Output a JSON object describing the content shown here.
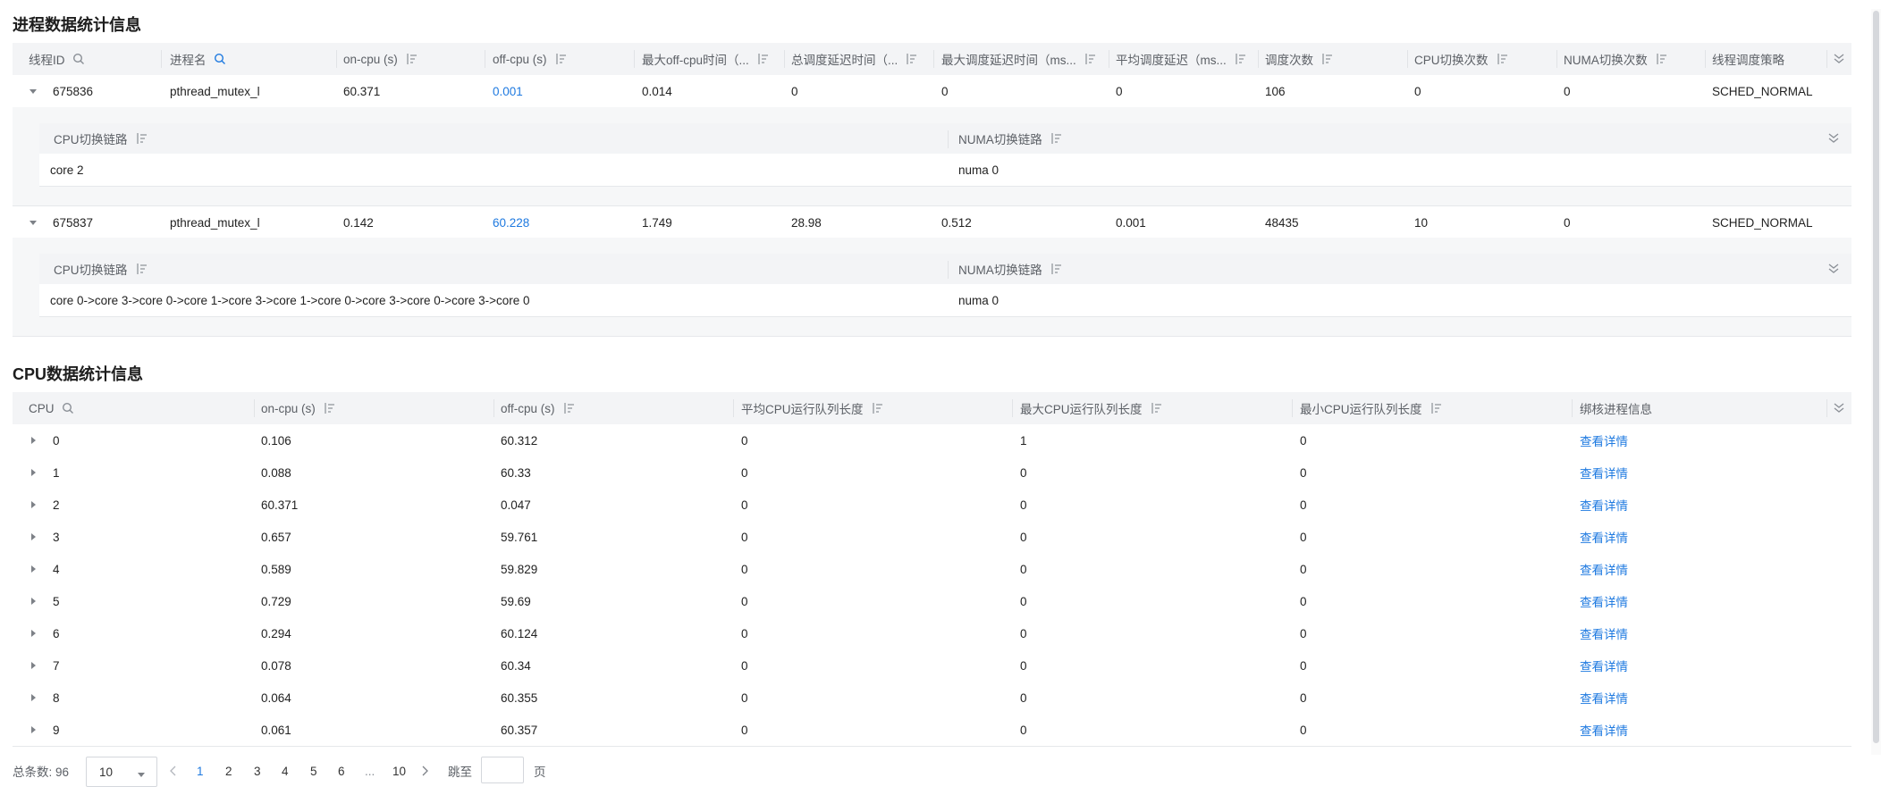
{
  "process_section": {
    "title": "进程数据统计信息",
    "columns": {
      "tid": "线程ID",
      "name": "进程名",
      "on_cpu": "on-cpu (s)",
      "off_cpu": "off-cpu (s)",
      "max_off_cpu": "最大off-cpu时间（...",
      "total_sched_delay": "总调度延迟时间（...",
      "max_sched_delay": "最大调度延迟时间（ms...",
      "avg_sched_delay": "平均调度延迟（ms...",
      "sched_count": "调度次数",
      "cpu_switch": "CPU切换次数",
      "numa_switch": "NUMA切换次数",
      "policy": "线程调度策略"
    },
    "rows": [
      {
        "tid": "675836",
        "name": "pthread_mutex_l",
        "on_cpu": "60.371",
        "off_cpu": "0.001",
        "max_off_cpu": "0.014",
        "total_sched_delay": "0",
        "max_sched_delay": "0",
        "avg_sched_delay": "0",
        "sched_count": "106",
        "cpu_switch": "0",
        "numa_switch": "0",
        "policy": "SCHED_NORMAL",
        "detail": {
          "cpu_chain_label": "CPU切换链路",
          "numa_chain_label": "NUMA切换链路",
          "cpu_chain": "core 2",
          "numa_chain": "numa 0"
        }
      },
      {
        "tid": "675837",
        "name": "pthread_mutex_l",
        "on_cpu": "0.142",
        "off_cpu": "60.228",
        "max_off_cpu": "1.749",
        "total_sched_delay": "28.98",
        "max_sched_delay": "0.512",
        "avg_sched_delay": "0.001",
        "sched_count": "48435",
        "cpu_switch": "10",
        "numa_switch": "0",
        "policy": "SCHED_NORMAL",
        "detail": {
          "cpu_chain_label": "CPU切换链路",
          "numa_chain_label": "NUMA切换链路",
          "cpu_chain": "core 0->core 3->core 0->core 1->core 3->core 1->core 0->core 3->core 0->core 3->core 0",
          "numa_chain": "numa 0"
        }
      }
    ]
  },
  "cpu_section": {
    "title": "CPU数据统计信息",
    "columns": {
      "cpu": "CPU",
      "on_cpu": "on-cpu (s)",
      "off_cpu": "off-cpu (s)",
      "avg_queue": "平均CPU运行队列长度",
      "max_queue": "最大CPU运行队列长度",
      "min_queue": "最小CPU运行队列长度",
      "bind_info": "绑核进程信息"
    },
    "link_label": "查看详情",
    "rows": [
      {
        "cpu": "0",
        "on_cpu": "0.106",
        "off_cpu": "60.312",
        "avg_queue": "0",
        "max_queue": "1",
        "min_queue": "0"
      },
      {
        "cpu": "1",
        "on_cpu": "0.088",
        "off_cpu": "60.33",
        "avg_queue": "0",
        "max_queue": "0",
        "min_queue": "0"
      },
      {
        "cpu": "2",
        "on_cpu": "60.371",
        "off_cpu": "0.047",
        "avg_queue": "0",
        "max_queue": "0",
        "min_queue": "0"
      },
      {
        "cpu": "3",
        "on_cpu": "0.657",
        "off_cpu": "59.761",
        "avg_queue": "0",
        "max_queue": "0",
        "min_queue": "0"
      },
      {
        "cpu": "4",
        "on_cpu": "0.589",
        "off_cpu": "59.829",
        "avg_queue": "0",
        "max_queue": "0",
        "min_queue": "0"
      },
      {
        "cpu": "5",
        "on_cpu": "0.729",
        "off_cpu": "59.69",
        "avg_queue": "0",
        "max_queue": "0",
        "min_queue": "0"
      },
      {
        "cpu": "6",
        "on_cpu": "0.294",
        "off_cpu": "60.124",
        "avg_queue": "0",
        "max_queue": "0",
        "min_queue": "0"
      },
      {
        "cpu": "7",
        "on_cpu": "0.078",
        "off_cpu": "60.34",
        "avg_queue": "0",
        "max_queue": "0",
        "min_queue": "0"
      },
      {
        "cpu": "8",
        "on_cpu": "0.064",
        "off_cpu": "60.355",
        "avg_queue": "0",
        "max_queue": "0",
        "min_queue": "0"
      },
      {
        "cpu": "9",
        "on_cpu": "0.061",
        "off_cpu": "60.357",
        "avg_queue": "0",
        "max_queue": "0",
        "min_queue": "0"
      }
    ]
  },
  "pagination": {
    "total_label": "总条数: 96",
    "page_size": "10",
    "pages": [
      "1",
      "2",
      "3",
      "4",
      "5",
      "6",
      "...",
      "10"
    ],
    "current_page": "1",
    "jump_label": "跳至",
    "jump_value": "",
    "page_suffix": "页"
  },
  "colors": {
    "link": "#1f7ae0",
    "header_bg": "#f3f4f6",
    "text": "#222222"
  },
  "icons": [
    "search-icon",
    "sort-icon",
    "collapse-columns-icon",
    "expand-row-icon",
    "chevron-down-icon",
    "prev-page-icon",
    "next-page-icon"
  ]
}
